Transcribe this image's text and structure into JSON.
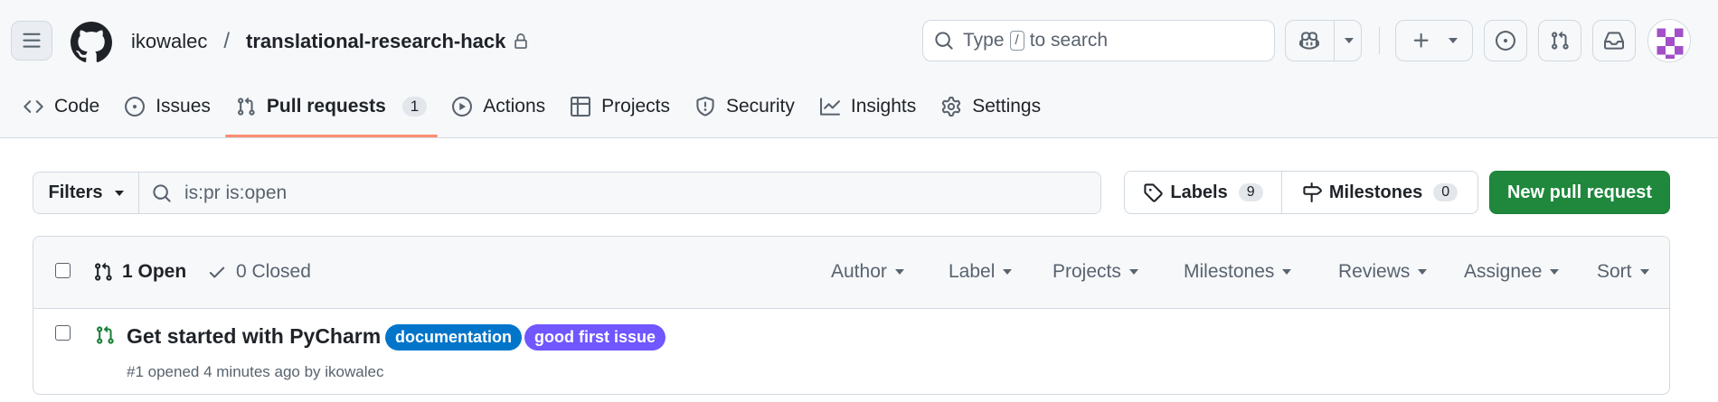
{
  "header": {
    "owner": "ikowalec",
    "separator": "/",
    "repo": "translational-research-hack",
    "search": {
      "prefix": "Type",
      "key": "/",
      "suffix": "to search"
    }
  },
  "nav": {
    "tabs": [
      {
        "label": "Code",
        "icon": "code-icon"
      },
      {
        "label": "Issues",
        "icon": "issue-opened-icon"
      },
      {
        "label": "Pull requests",
        "icon": "git-pull-request-icon",
        "count": "1",
        "selected": true
      },
      {
        "label": "Actions",
        "icon": "play-icon"
      },
      {
        "label": "Projects",
        "icon": "table-icon"
      },
      {
        "label": "Security",
        "icon": "shield-icon"
      },
      {
        "label": "Insights",
        "icon": "graph-icon"
      },
      {
        "label": "Settings",
        "icon": "gear-icon"
      }
    ]
  },
  "toolbar": {
    "filters_label": "Filters",
    "query": "is:pr is:open",
    "labels": {
      "label": "Labels",
      "count": "9"
    },
    "milestones": {
      "label": "Milestones",
      "count": "0"
    },
    "new_pr_label": "New pull request"
  },
  "list": {
    "open_label": "1 Open",
    "closed_label": "0 Closed",
    "filters": [
      "Author",
      "Label",
      "Projects",
      "Milestones",
      "Reviews",
      "Assignee",
      "Sort"
    ],
    "items": [
      {
        "title": "Get started with PyCharm",
        "labels": [
          {
            "name": "documentation",
            "color": "#0075ca"
          },
          {
            "name": "good first issue",
            "color": "#7057ff"
          }
        ],
        "meta": "#1 opened 4 minutes ago by ikowalec"
      }
    ]
  },
  "colors": {
    "accent_underline": "#fd8c73",
    "primary_button": "#1f883d",
    "open_icon": "#1a7f37"
  }
}
